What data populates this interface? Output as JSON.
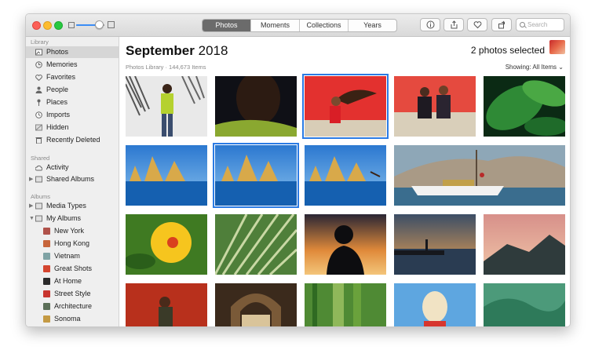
{
  "toolbar": {
    "tabs": [
      {
        "label": "Photos",
        "active": true
      },
      {
        "label": "Moments",
        "active": false
      },
      {
        "label": "Collections",
        "active": false
      },
      {
        "label": "Years",
        "active": false
      }
    ],
    "zoom_level": 0.8,
    "search_placeholder": "Search",
    "buttons": [
      "info-icon",
      "share-icon",
      "heart-icon",
      "rotate-icon"
    ]
  },
  "sidebar": {
    "library_header": "Library",
    "library_items": [
      {
        "label": "Photos",
        "icon": "photos-icon",
        "selected": true
      },
      {
        "label": "Memories",
        "icon": "memories-icon"
      },
      {
        "label": "Favorites",
        "icon": "heart-icon"
      },
      {
        "label": "People",
        "icon": "person-icon"
      },
      {
        "label": "Places",
        "icon": "pin-icon"
      },
      {
        "label": "Imports",
        "icon": "clock-icon"
      },
      {
        "label": "Hidden",
        "icon": "hidden-icon"
      },
      {
        "label": "Recently Deleted",
        "icon": "trash-icon"
      }
    ],
    "shared_header": "Shared",
    "shared_items": [
      {
        "label": "Activity",
        "icon": "cloud-icon"
      },
      {
        "label": "Shared Albums",
        "icon": "album-folder-icon",
        "disclosure": "▶"
      }
    ],
    "albums_header": "Albums",
    "albums_items": [
      {
        "label": "Media Types",
        "icon": "album-folder-icon",
        "disclosure": "▶"
      },
      {
        "label": "My Albums",
        "icon": "album-folder-icon",
        "disclosure": "▼"
      }
    ],
    "my_albums": [
      {
        "label": "New York",
        "color": "#b0524a"
      },
      {
        "label": "Hong Kong",
        "color": "#c7653b"
      },
      {
        "label": "Vietnam",
        "color": "#7fa3a5"
      },
      {
        "label": "Great Shots",
        "color": "#d4452f"
      },
      {
        "label": "At Home",
        "color": "#2b2b2b"
      },
      {
        "label": "Street Style",
        "color": "#c8352e"
      },
      {
        "label": "Architecture",
        "color": "#5b6f58"
      },
      {
        "label": "Sonoma",
        "color": "#c49a44"
      }
    ]
  },
  "main": {
    "title_month": "September",
    "title_year": "2018",
    "subtitle": "Photos Library · 144,673 Items",
    "selected_count": "2 photos selected",
    "showing_label": "Showing: All Items"
  },
  "photos": [
    {
      "name": "palm-man-photo",
      "picked": false
    },
    {
      "name": "portrait-profile-photo",
      "picked": false
    },
    {
      "name": "hair-flip-photo",
      "picked": true
    },
    {
      "name": "two-women-bench-photo",
      "picked": false
    },
    {
      "name": "leaves-photo",
      "picked": false
    },
    {
      "name": "faraglioni-1-photo",
      "picked": false
    },
    {
      "name": "faraglioni-2-photo",
      "picked": true
    },
    {
      "name": "faraglioni-dive-photo",
      "picked": false
    },
    {
      "name": "positano-boat-photo",
      "picked": false
    },
    {
      "name": "hibiscus-photo",
      "picked": false
    },
    {
      "name": "palm-frond-photo",
      "picked": false
    },
    {
      "name": "silhouette-sunset-photo",
      "picked": false
    },
    {
      "name": "pier-sunset-photo",
      "picked": false
    },
    {
      "name": "mountain-clouds-photo",
      "picked": false
    },
    {
      "name": "red-wall-woman-photo",
      "picked": false
    },
    {
      "name": "arches-photo",
      "picked": false
    },
    {
      "name": "bamboo-photo",
      "picked": false
    },
    {
      "name": "blonde-woman-photo",
      "picked": false
    },
    {
      "name": "green-water-photo",
      "picked": false
    }
  ]
}
